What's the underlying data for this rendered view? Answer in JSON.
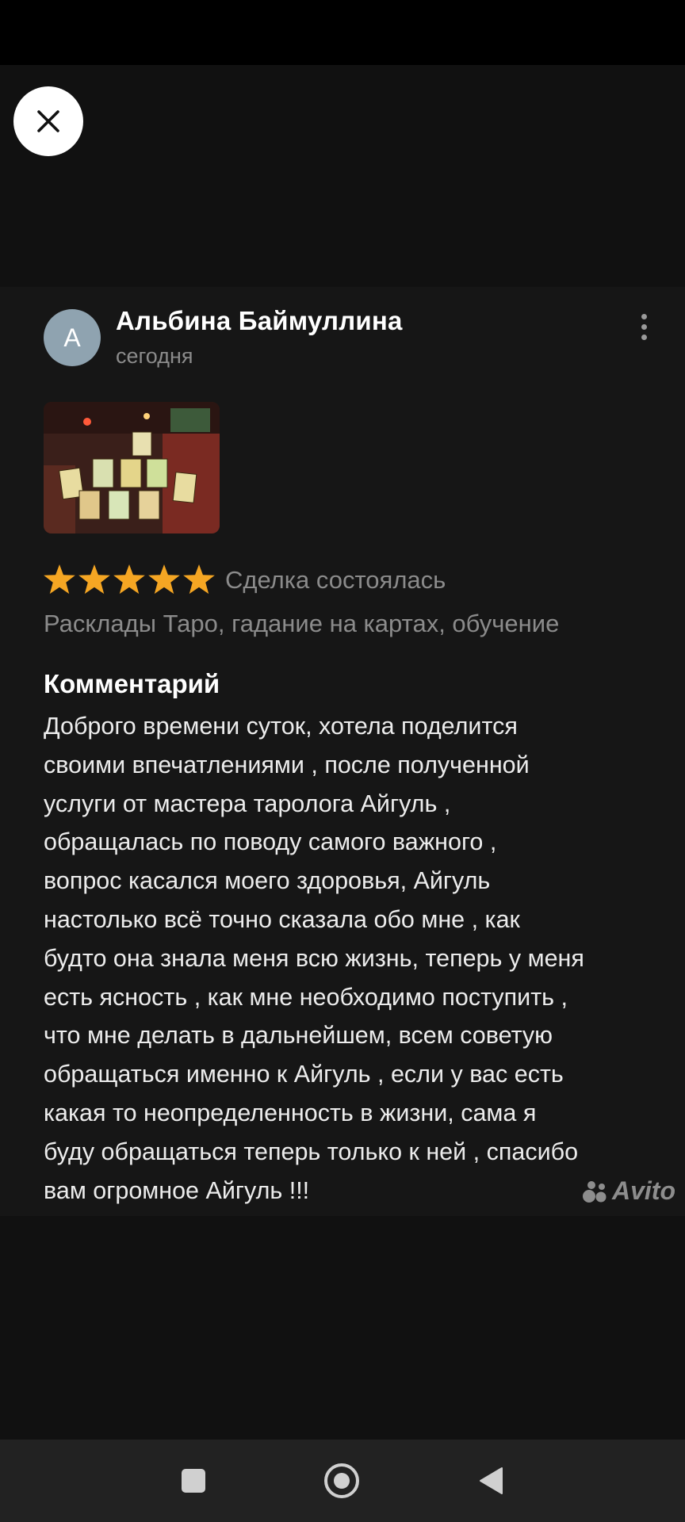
{
  "review": {
    "avatar_letter": "А",
    "author_name": "Альбина Баймуллина",
    "date": "сегодня",
    "rating": 5,
    "deal_status": "Сделка состоялась",
    "service": "Расклады Таро, гадание на картах, обучение",
    "comment_heading": "Комментарий",
    "comment_lines": [
      "Доброго времени суток, хотела поделится",
      "своими впечатлениями , после полученной",
      "услуги от мастера таролога Айгуль ,",
      "обращалась по поводу самого важного ,",
      "вопрос касался моего здоровья, Айгуль",
      "настолько всё точно сказала обо мне , как",
      "будто она знала меня всю жизнь, теперь у меня",
      "есть ясность , как мне необходимо поступить ,",
      "что мне делать в дальнейшем, всем советую",
      "обращаться именно к Айгуль , если у вас есть",
      "какая то неопределенность в жизни, сама я",
      "буду обращаться теперь только к ней , спасибо",
      "вам огромное Айгуль !!!"
    ]
  },
  "watermark": {
    "text": "Avito"
  },
  "icons": {
    "close": "close-icon",
    "more": "more-vertical-icon",
    "star": "star-icon",
    "nav_recents": "square-icon",
    "nav_home": "circle-icon",
    "nav_back": "triangle-back-icon"
  },
  "colors": {
    "star": "#F5A623",
    "background": "#111111",
    "avatar": "#8FA3B0"
  }
}
